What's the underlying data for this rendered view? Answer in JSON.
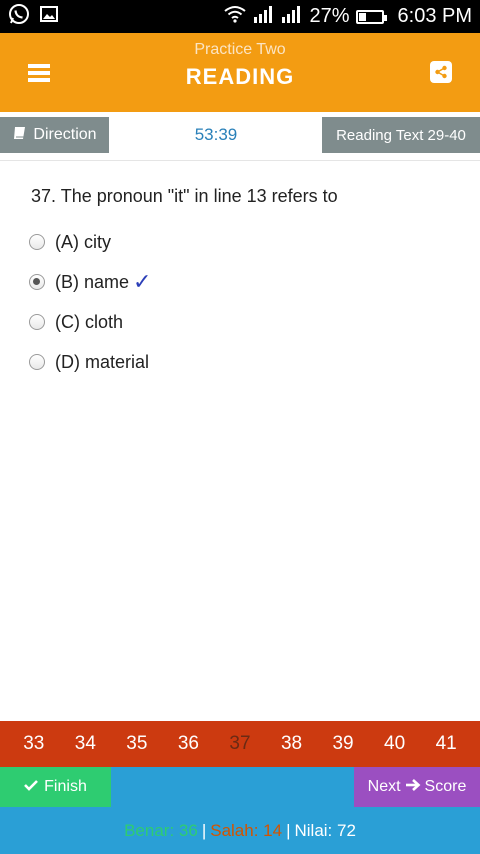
{
  "status_bar": {
    "signal_percent": "27%",
    "time": "6:03 PM",
    "battery_percent": 27,
    "icons": [
      "whatsapp-icon",
      "image-icon",
      "wifi-icon",
      "signal-icon",
      "signal-icon",
      "battery-icon"
    ]
  },
  "header": {
    "subtitle": "Practice Two",
    "title": "READING",
    "menu_icon": "hamburger-menu-icon",
    "share_icon": "share-icon"
  },
  "tabs": {
    "direction_label": "Direction",
    "timer": "53:39",
    "reading_text_label": "Reading Text 29-40"
  },
  "question": {
    "text": "37. The pronoun \"it\" in line 13 refers to",
    "options": [
      {
        "label": "(A) city",
        "selected": false
      },
      {
        "label": "(B) name",
        "selected": true
      },
      {
        "label": "(C) cloth",
        "selected": false
      },
      {
        "label": "(D) material",
        "selected": false
      }
    ],
    "check_mark": "✓"
  },
  "pagination": {
    "pages": [
      "33",
      "34",
      "35",
      "36",
      "37",
      "38",
      "39",
      "40",
      "41"
    ],
    "current": "37"
  },
  "actions": {
    "finish_label": "Finish",
    "next_label": "Next",
    "score_label": "Score"
  },
  "score": {
    "benar": "Benar: 36",
    "salah": "Salah: 14",
    "nilai": "Nilai: 72",
    "separator": "|"
  },
  "colors": {
    "header": "#f39c12",
    "tab_gray": "#7f8c8d",
    "timer_text": "#2980b9",
    "pagination_bg": "#cc3a10",
    "finish_green": "#2ecc71",
    "next_purple": "#9b4fc1",
    "score_blue": "#2a9fd6"
  }
}
